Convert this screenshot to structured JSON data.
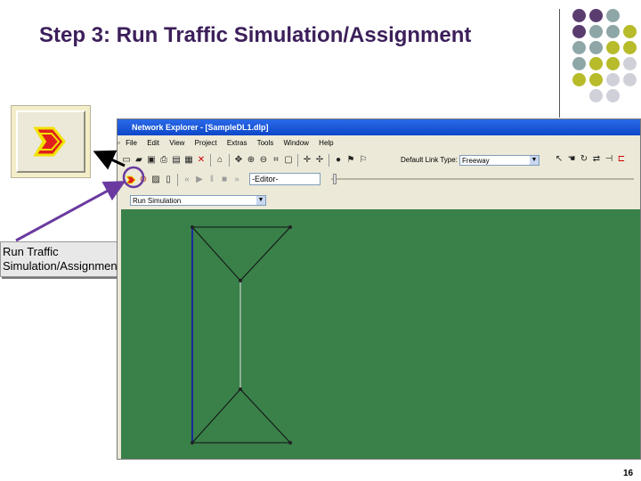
{
  "slide": {
    "title": "Step 3: Run Traffic Simulation/Assignment",
    "page_number": "16"
  },
  "callout": {
    "line1": "Run Traffic",
    "line2": "Simulation/Assignment"
  },
  "app": {
    "window_title": "Network Explorer - [SampleDL1.dlp]",
    "menu": [
      "File",
      "Edit",
      "View",
      "Project",
      "Extras",
      "Tools",
      "Window",
      "Help"
    ],
    "link_type_label": "Default Link Type:",
    "link_type_value": "Freeway",
    "editor_label": "-Editor-",
    "mode_value": "Run Simulation"
  },
  "colors": {
    "title": "#3c1f5a",
    "canvas": "#398049",
    "annotation": "#6a3aa0",
    "dot_purple": "#5a3d6e",
    "dot_gray": "#8fa6a6",
    "dot_olive": "#b8bb2a",
    "dot_light": "#d0d0d8"
  },
  "icons": {
    "run_button": "red-run-arrow-icon"
  }
}
